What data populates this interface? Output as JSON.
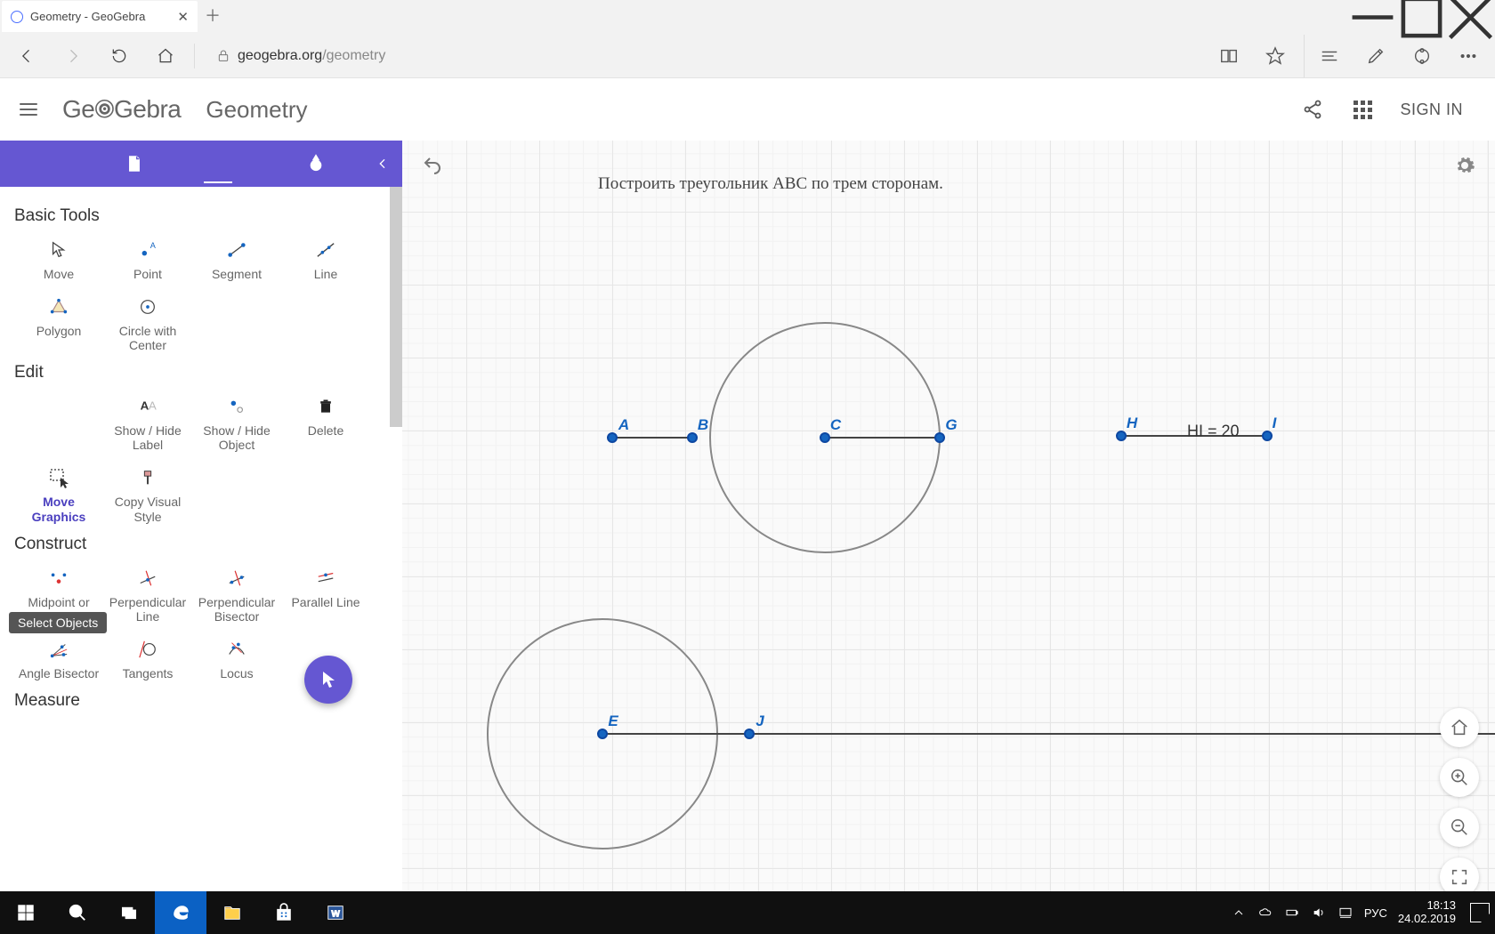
{
  "browser": {
    "tab_title": "Geometry - GeoGebra",
    "url_host": "geogebra.org",
    "url_path": "/geometry"
  },
  "app": {
    "logo": "GeoGebra",
    "title": "Geometry",
    "signin": "SIGN IN"
  },
  "sidebar": {
    "sections": {
      "basic": "Basic Tools",
      "edit": "Edit",
      "construct": "Construct",
      "measure": "Measure"
    },
    "tools": {
      "move": "Move",
      "point": "Point",
      "segment": "Segment",
      "line": "Line",
      "polygon": "Polygon",
      "circle_center": "Circle with Center",
      "show_hide_label": "Show / Hide Label",
      "show_hide_object": "Show / Hide Object",
      "delete": "Delete",
      "move_graphics": "Move Graphics",
      "copy_visual": "Copy Visual Style",
      "midpoint": "Midpoint or Center",
      "perp_line": "Perpendicular Line",
      "perp_bisector": "Perpendicular Bisector",
      "parallel": "Parallel Line",
      "angle_bisector": "Angle Bisector",
      "tangents": "Tangents",
      "locus": "Locus"
    },
    "tooltip": "Select Objects"
  },
  "canvas": {
    "prompt": "Построить треугольник ABC по трем сторонам.",
    "points": {
      "A": "A",
      "B": "B",
      "C": "C",
      "G": "G",
      "H": "H",
      "I": "I",
      "E": "E",
      "J": "J"
    },
    "measurement": "HI = 20"
  },
  "system": {
    "lang": "РУС",
    "time": "18:13",
    "date": "24.02.2019"
  }
}
